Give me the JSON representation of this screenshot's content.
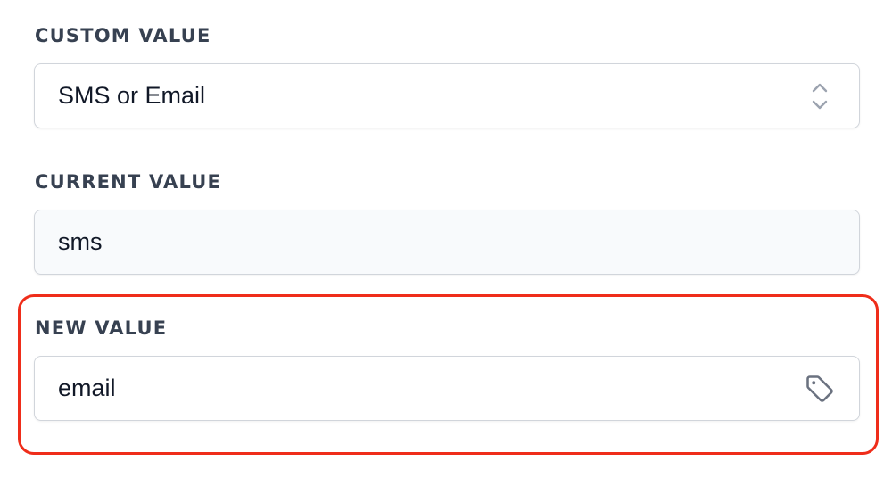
{
  "custom_value": {
    "label": "CUSTOM VALUE",
    "selected": "SMS or Email",
    "icon": "chevron-up-down-icon"
  },
  "current_value": {
    "label": "CURRENT VALUE",
    "value": "sms"
  },
  "new_value": {
    "label": "NEW VALUE",
    "value": "email",
    "icon": "tag-icon"
  },
  "colors": {
    "highlight": "#ef2d1a",
    "label": "#374151",
    "border": "#d1d5db"
  }
}
